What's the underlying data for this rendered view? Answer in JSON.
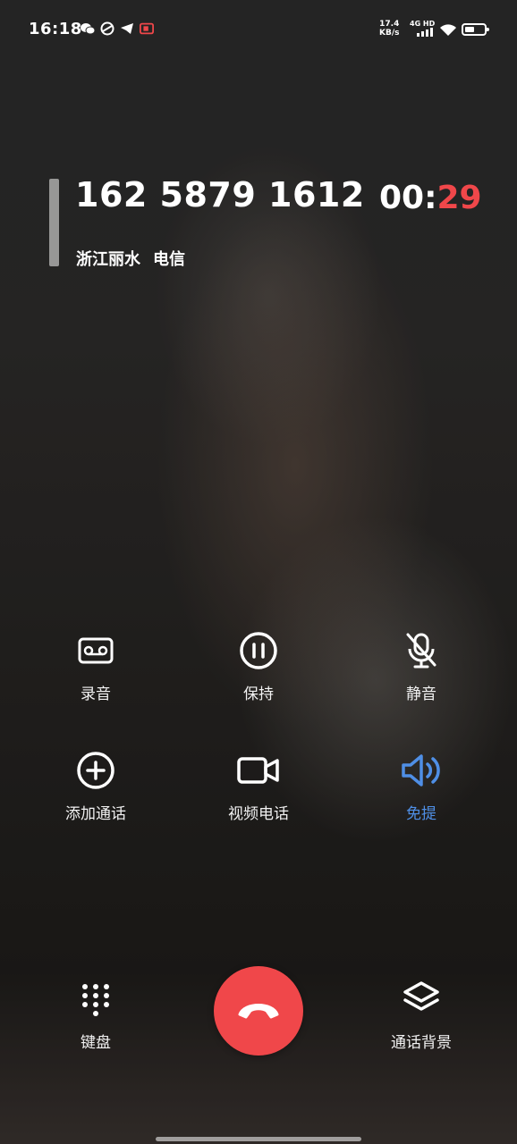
{
  "status_bar": {
    "time": "16:18",
    "net_speed_value": "17.4",
    "net_speed_unit": "KB/s",
    "network_type": "4G HD",
    "battery_level": 0.5,
    "left_icons": [
      "wechat-icon",
      "app-icon",
      "telegram-icon",
      "screen-record-icon"
    ]
  },
  "call": {
    "number": "162 5879 1612",
    "region": "浙江丽水",
    "carrier": "电信",
    "timer_min": "00:",
    "timer_sec": "29"
  },
  "controls": {
    "record": "录音",
    "hold": "保持",
    "mute": "静音",
    "add_call": "添加通话",
    "video_call": "视频电话",
    "speaker": "免提",
    "keypad": "键盘",
    "call_background": "通话背景"
  },
  "colors": {
    "accent_blue": "#4f8fe6",
    "end_call_red": "#f0474a",
    "timer_red": "#f0474a"
  }
}
